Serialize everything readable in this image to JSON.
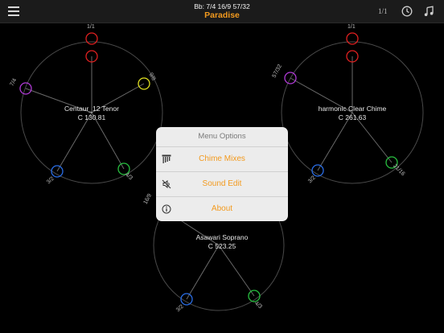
{
  "header": {
    "subtitle": "Bb: 7/4 16/9 57/32",
    "title": "Paradise",
    "ratio_button": "1/1"
  },
  "icons": {
    "menu": "hamburger-menu-icon",
    "history": "clock-icon",
    "music": "music-note-icon"
  },
  "colors": {
    "accent": "#f39a1e",
    "red": "#e02020",
    "purple": "#b03ad6",
    "yellow": "#e0e020",
    "blue": "#2a6ee8",
    "green": "#28c040"
  },
  "wheels": [
    {
      "name": "Centaur_12 Tenor",
      "pitch": "C 130.81",
      "ratios": [
        "1/1",
        "7/4",
        "9/8",
        "3/2",
        "4/3"
      ]
    },
    {
      "name": "harmonic Clear Chime",
      "pitch": "C 261.63",
      "ratios": [
        "1/1",
        "57/32",
        "3/2",
        "21/16"
      ]
    },
    {
      "name": "Asawari Soprano",
      "pitch": "C 523.25",
      "ratios": [
        "16/9",
        "3/2",
        "4/3"
      ]
    }
  ],
  "menu": {
    "header": "Menu Options",
    "items": [
      {
        "label": "Chime Mixes",
        "icon": "chime-bars-icon"
      },
      {
        "label": "Sound Edit",
        "icon": "sound-off-icon"
      },
      {
        "label": "About",
        "icon": "info-icon"
      }
    ]
  }
}
